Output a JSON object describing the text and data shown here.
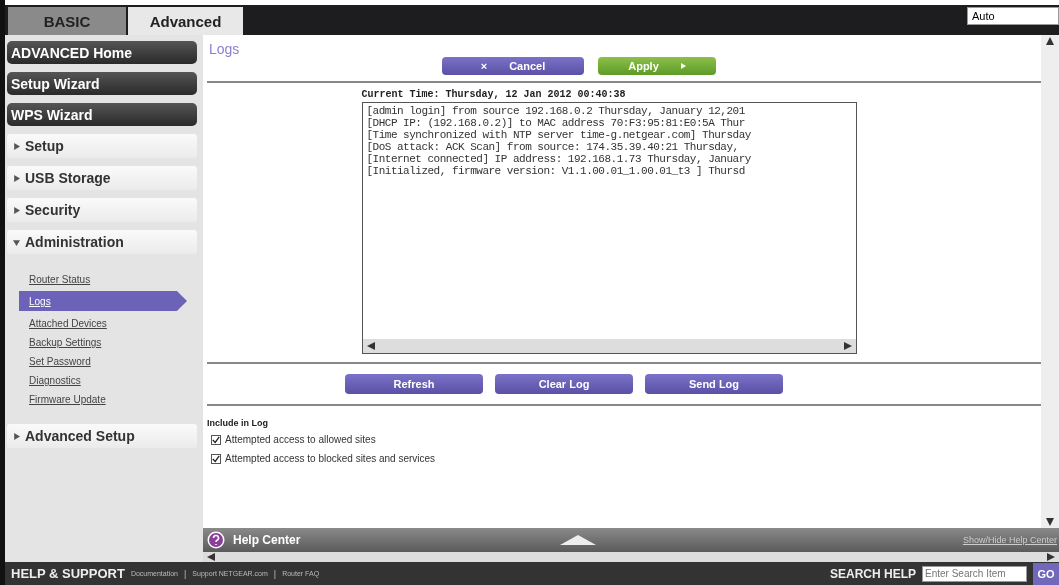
{
  "tabs": [
    {
      "label": "BASIC",
      "selected": false
    },
    {
      "label": "Advanced",
      "selected": true
    }
  ],
  "language_select": {
    "value": "Auto"
  },
  "sidebar": [
    {
      "label": "ADVANCED Home",
      "kind": "primary"
    },
    {
      "label": "Setup Wizard",
      "kind": "primary"
    },
    {
      "label": "WPS Wizard",
      "kind": "primary"
    },
    {
      "label": "Setup",
      "kind": "section",
      "expanded": false
    },
    {
      "label": "USB Storage",
      "kind": "section",
      "expanded": false
    },
    {
      "label": "Security",
      "kind": "section",
      "expanded": false
    },
    {
      "label": "Administration",
      "kind": "section",
      "expanded": true,
      "children": [
        {
          "label": "Router Status",
          "selected": false
        },
        {
          "label": "Logs",
          "selected": true
        },
        {
          "label": "Attached Devices",
          "selected": false
        },
        {
          "label": "Backup Settings",
          "selected": false
        },
        {
          "label": "Set Password",
          "selected": false
        },
        {
          "label": "Diagnostics",
          "selected": false
        },
        {
          "label": "Firmware Update",
          "selected": false
        }
      ]
    },
    {
      "label": "Advanced Setup",
      "kind": "section",
      "expanded": false
    }
  ],
  "page": {
    "title": "Logs",
    "cancel_icon": "×",
    "cancel": "Cancel",
    "apply": "Apply",
    "current_time": "Current Time: Thursday, 12 Jan 2012 00:40:38",
    "log_lines": [
      "[admin login] from source 192.168.0.2 Thursday, January 12,201",
      "[DHCP IP: (192.168.0.2)] to MAC address 70:F3:95:81:E0:5A Thur",
      "[Time synchronized with NTP server time-g.netgear.com] Thursday",
      "[DoS attack: ACK Scan] from source: 174.35.39.40:21 Thursday,",
      "[Internet connected] IP address: 192.168.1.73 Thursday, January",
      "[Initialized, firmware version: V1.1.00.01_1.00.01_t3 ] Thursd"
    ],
    "buttons": [
      "Refresh",
      "Clear Log",
      "Send Log"
    ],
    "include_heading": "Include in Log",
    "options": [
      {
        "label": "Attempted access to allowed sites",
        "checked": true
      },
      {
        "label": "Attempted access to blocked sites and services",
        "checked": true
      }
    ]
  },
  "help_center": {
    "title": "Help Center",
    "toggle": "Show/Hide Help Center"
  },
  "footer": {
    "title": "HELP & SUPPORT",
    "links": [
      {
        "kind": "link",
        "label": "Documentation"
      },
      {
        "kind": "separator",
        "label": "|"
      },
      {
        "kind": "link",
        "label": "Support NETGEAR.com"
      },
      {
        "kind": "separator",
        "label": "|"
      },
      {
        "kind": "link",
        "label": "Router FAQ"
      }
    ],
    "search_label": "SEARCH HELP",
    "search_placeholder": "Enter Search Item",
    "go": "GO"
  }
}
